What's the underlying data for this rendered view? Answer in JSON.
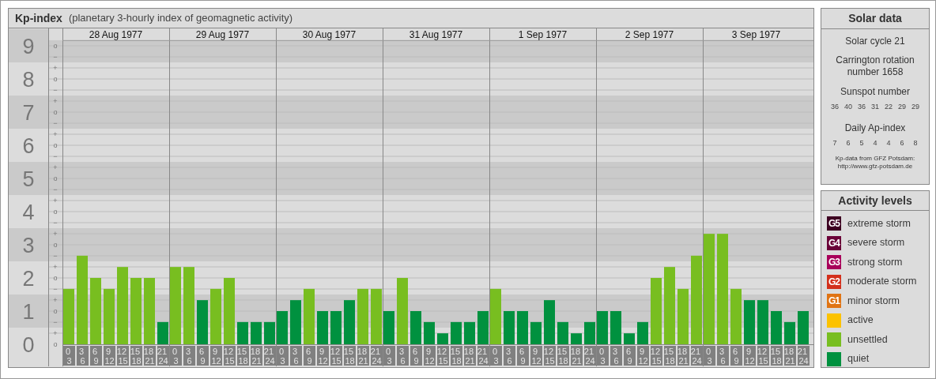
{
  "header": {
    "title": "Kp-index",
    "subtitle": "(planetary 3-hourly index of geomagnetic activity)"
  },
  "chart": {
    "days": [
      "28 Aug 1977",
      "29 Aug 1977",
      "30 Aug 1977",
      "31 Aug 1977",
      "1 Sep 1977",
      "2 Sep 1977",
      "3 Sep 1977"
    ],
    "minor_ticks": [
      "o",
      "−",
      "+",
      "o",
      "−",
      "+",
      "o",
      "−",
      "+",
      "o",
      "−",
      "+",
      "o",
      "−",
      "+",
      "o",
      "−",
      "+",
      "o",
      "−",
      "+",
      "o",
      "−",
      "+",
      "o",
      "−",
      "+",
      "o"
    ],
    "chart_data": {
      "type": "bar",
      "ylim": [
        0,
        9.17
      ],
      "yticks": [
        0,
        1,
        2,
        3,
        4,
        5,
        6,
        7,
        8,
        9
      ],
      "grid": true,
      "categories": [
        "0 3",
        "3 6",
        "6 9",
        "9 12",
        "12 15",
        "15 18",
        "18 21",
        "21 24",
        "0 3",
        "3 6",
        "6 9",
        "9 12",
        "12 15",
        "15 18",
        "18 21",
        "21 24",
        "0 3",
        "3 6",
        "6 9",
        "9 12",
        "12 15",
        "15 18",
        "18 21",
        "21 24",
        "0 3",
        "3 6",
        "6 9",
        "9 12",
        "12 15",
        "15 18",
        "18 21",
        "21 24",
        "0 3",
        "3 6",
        "6 9",
        "9 12",
        "12 15",
        "15 18",
        "18 21",
        "21 24",
        "0 3",
        "3 6",
        "6 9",
        "9 12",
        "12 15",
        "15 18",
        "18 21",
        "21 24",
        "0 3",
        "3 6",
        "6 9",
        "9 12",
        "12 15",
        "15 18",
        "18 21",
        "21 24"
      ],
      "series": [
        {
          "color": "#78be20",
          "values": [
            1.67,
            2.67,
            2,
            1.67,
            2.33,
            2,
            2,
            null,
            2.33,
            2.33,
            null,
            1.67,
            2,
            null,
            null,
            null,
            null,
            null,
            1.67,
            null,
            null,
            null,
            1.67,
            1.67,
            null,
            2,
            null,
            null,
            null,
            null,
            null,
            null,
            1.67,
            null,
            null,
            null,
            null,
            null,
            null,
            null,
            null,
            null,
            null,
            null,
            2,
            2.33,
            1.67,
            2.67,
            3.33,
            3.33,
            1.67,
            null,
            null,
            null,
            null,
            null
          ]
        },
        {
          "color": "#00913f",
          "values": [
            null,
            null,
            null,
            null,
            null,
            null,
            null,
            0.67,
            null,
            null,
            1.33,
            null,
            null,
            0.67,
            0.67,
            0.67,
            1,
            1.33,
            null,
            1,
            1,
            1.33,
            null,
            null,
            1,
            null,
            1,
            0.67,
            0.33,
            0.67,
            0.67,
            1,
            null,
            1,
            1,
            0.67,
            1.33,
            0.67,
            0.33,
            0.67,
            1,
            1,
            0.33,
            0.67,
            null,
            null,
            null,
            null,
            null,
            null,
            null,
            1.33,
            1.33,
            1,
            0.67,
            1
          ]
        }
      ]
    }
  },
  "solar_data": {
    "title": "Solar data",
    "cycle": "Solar cycle 21",
    "carrington": "Carrington rotation number 1658",
    "sunspot_label": "Sunspot number",
    "sunspot_numbers": [
      "36",
      "40",
      "36",
      "31",
      "22",
      "29",
      "29"
    ],
    "ap_label": "Daily Ap-index",
    "ap_values": [
      "7",
      "6",
      "5",
      "4",
      "4",
      "6",
      "8"
    ],
    "source": "Kp-data from GFZ Potsdam:",
    "source_url": "http://www.gfz-potsdam.de"
  },
  "activity_levels": {
    "title": "Activity levels",
    "items": [
      {
        "code": "G5",
        "label": "extreme storm",
        "color": "#3d0021"
      },
      {
        "code": "G4",
        "label": "severe storm",
        "color": "#6a0038"
      },
      {
        "code": "G3",
        "label": "strong storm",
        "color": "#a8005a"
      },
      {
        "code": "G2",
        "label": "moderate storm",
        "color": "#d3301c"
      },
      {
        "code": "G1",
        "label": "minor storm",
        "color": "#e07414"
      },
      {
        "label": "active",
        "color": "#fcc200"
      },
      {
        "label": "unsettled",
        "color": "#78be20"
      },
      {
        "label": "quiet",
        "color": "#00913f"
      }
    ]
  }
}
